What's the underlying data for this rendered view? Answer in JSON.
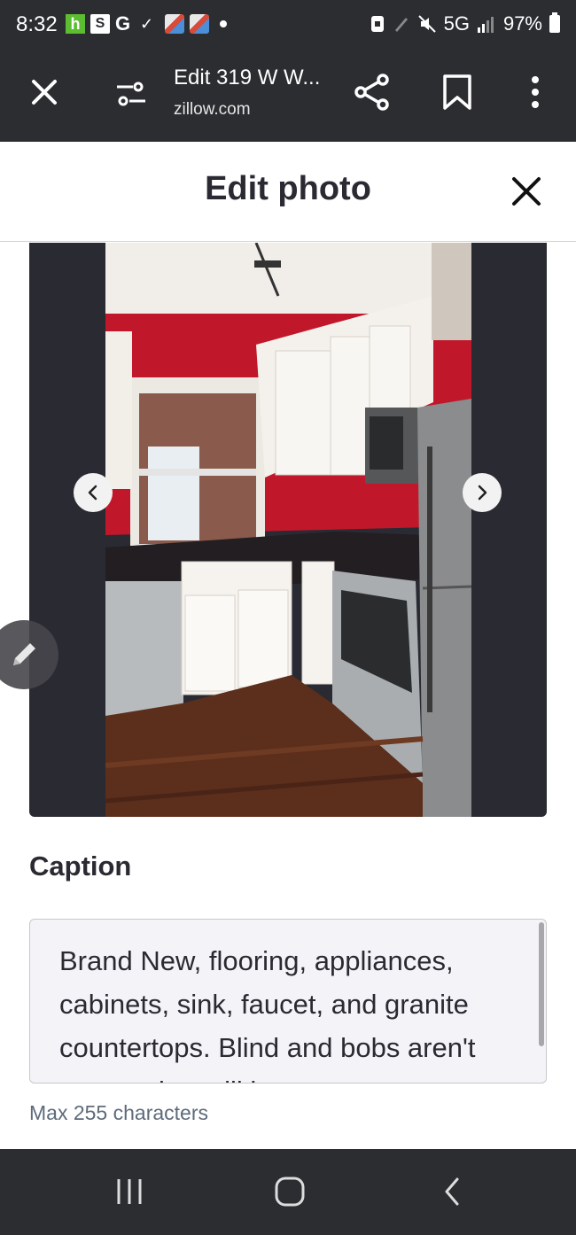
{
  "status_bar": {
    "time": "8:32",
    "network": "5G",
    "battery": "97%",
    "icons": [
      "houzz-icon",
      "s-icon",
      "google-icon",
      "check-icon",
      "maps-icon",
      "maps-icon",
      "dot-icon",
      "lock-icon",
      "pen-icon",
      "mute-icon",
      "signal-icon",
      "battery-icon"
    ]
  },
  "browser": {
    "title": "Edit 319 W W...",
    "url": "zillow.com"
  },
  "sheet": {
    "title": "Edit photo"
  },
  "photo": {
    "description_icon": "kitchen-photo"
  },
  "caption": {
    "label": "Caption",
    "value": "Brand New, flooring, appliances, cabinets, sink, faucet, and granite countertops. Blind and bobs aren't present but will be",
    "hint": "Max 255 characters"
  },
  "colors": {
    "bar_bg": "#2b2d31",
    "text_dark": "#2a2a33",
    "hint": "#5d6b7a"
  }
}
